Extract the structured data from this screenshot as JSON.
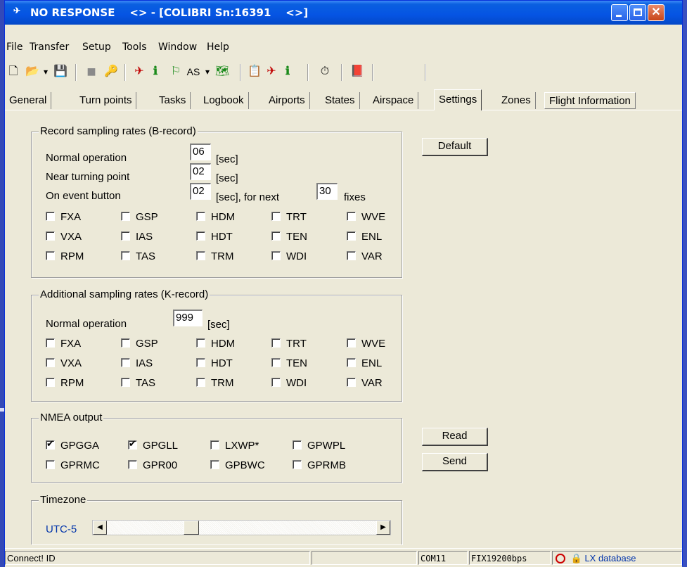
{
  "window": {
    "title": "NO RESPONSE    <> - [COLIBRI Sn:16391    <>]",
    "minimize_icon": "minimize-icon",
    "maximize_icon": "maximize-icon",
    "close_glyph": "✕"
  },
  "menu": [
    "File",
    "Transfer",
    "Setup",
    "Tools",
    "Window",
    "Help"
  ],
  "toolbar": {
    "items": [
      {
        "icon": "new-file-icon",
        "glyph": "🗋"
      },
      {
        "icon": "open-folder-icon",
        "glyph": "📂"
      },
      {
        "icon": "dropdown-arrow-icon",
        "glyph": "▾"
      },
      {
        "icon": "save-icon",
        "glyph": "💾"
      },
      {
        "icon": "gray-square-icon",
        "glyph": "■"
      },
      {
        "icon": "key-icon",
        "glyph": "🔑"
      },
      {
        "icon": "flight-tool-icon",
        "glyph": "✈"
      },
      {
        "icon": "info-icon",
        "glyph": "ℹ"
      },
      {
        "icon": "task-icon",
        "glyph": "⚐"
      },
      {
        "icon": "as-label",
        "glyph": "AS"
      },
      {
        "icon": "dropdown-arrow-icon",
        "glyph": "▾"
      },
      {
        "icon": "map-icon",
        "glyph": "🗺"
      },
      {
        "icon": "logbook-icon",
        "glyph": "📋"
      },
      {
        "icon": "flight-tool2-icon",
        "glyph": "✈"
      },
      {
        "icon": "info2-icon",
        "glyph": "ℹ"
      },
      {
        "icon": "stopwatch-icon",
        "glyph": "⏱"
      },
      {
        "icon": "book-icon",
        "glyph": "📕"
      }
    ]
  },
  "tabs": [
    "General",
    "Turn points",
    "Tasks",
    "Logbook",
    "Airports",
    "States",
    "Airspace",
    "Settings",
    "Zones",
    "Flight Information"
  ],
  "active_tab": "Settings",
  "b_record": {
    "title": "Record sampling rates (B-record)",
    "normal_label": "Normal operation",
    "normal_value": "06",
    "near_label": "Near turning point",
    "near_value": "02",
    "event_label": "On event button",
    "event_value": "02",
    "sec_unit": "[sec]",
    "sec_for_next": "[sec], for next",
    "fixes_value": "30",
    "fixes_label": "fixes",
    "checks": [
      {
        "label": "FXA",
        "checked": false
      },
      {
        "label": "GSP",
        "checked": false
      },
      {
        "label": "HDM",
        "checked": false
      },
      {
        "label": "TRT",
        "checked": false
      },
      {
        "label": "WVE",
        "checked": false
      },
      {
        "label": "VXA",
        "checked": false
      },
      {
        "label": "IAS",
        "checked": false
      },
      {
        "label": "HDT",
        "checked": false
      },
      {
        "label": "TEN",
        "checked": false
      },
      {
        "label": "ENL",
        "checked": false
      },
      {
        "label": "RPM",
        "checked": false
      },
      {
        "label": "TAS",
        "checked": false
      },
      {
        "label": "TRM",
        "checked": false
      },
      {
        "label": "WDI",
        "checked": false
      },
      {
        "label": "VAR",
        "checked": false
      }
    ]
  },
  "k_record": {
    "title": "Additional sampling rates (K-record)",
    "normal_label": "Normal operation",
    "normal_value": "999",
    "sec_unit": "[sec]",
    "checks": [
      {
        "label": "FXA",
        "checked": false
      },
      {
        "label": "GSP",
        "checked": false
      },
      {
        "label": "HDM",
        "checked": false
      },
      {
        "label": "TRT",
        "checked": false
      },
      {
        "label": "WVE",
        "checked": false
      },
      {
        "label": "VXA",
        "checked": false
      },
      {
        "label": "IAS",
        "checked": false
      },
      {
        "label": "HDT",
        "checked": false
      },
      {
        "label": "TEN",
        "checked": false
      },
      {
        "label": "ENL",
        "checked": false
      },
      {
        "label": "RPM",
        "checked": false
      },
      {
        "label": "TAS",
        "checked": false
      },
      {
        "label": "TRM",
        "checked": false
      },
      {
        "label": "WDI",
        "checked": false
      },
      {
        "label": "VAR",
        "checked": false
      }
    ]
  },
  "nmea": {
    "title": "NMEA output",
    "checks": [
      {
        "label": "GPGGA",
        "checked": true
      },
      {
        "label": "GPGLL",
        "checked": true
      },
      {
        "label": "LXWP*",
        "checked": false
      },
      {
        "label": "GPWPL",
        "checked": false
      },
      {
        "label": "GPRMC",
        "checked": false
      },
      {
        "label": "GPR00",
        "checked": false
      },
      {
        "label": "GPBWC",
        "checked": false
      },
      {
        "label": "GPRMB",
        "checked": false
      }
    ]
  },
  "timezone": {
    "title": "Timezone",
    "value": "UTC-5",
    "slider_fraction": 0.3,
    "left_arrow": "◀",
    "right_arrow": "▶"
  },
  "buttons": {
    "default": "Default",
    "read": "Read",
    "send": "Send"
  },
  "status": {
    "message": "Connect! ID",
    "port": "COM11",
    "rate": "FIX19200bps",
    "database": "LX database"
  }
}
